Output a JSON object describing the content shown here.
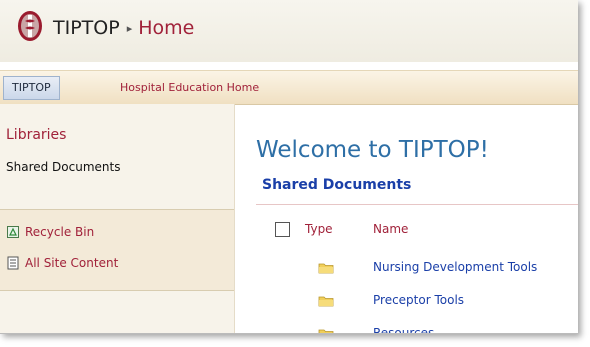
{
  "header": {
    "site_name": "TIPTOP",
    "breadcrumb_separator": "▸",
    "current_page": "Home"
  },
  "topnav": {
    "active_tab": "TIPTOP",
    "tabs": [
      "Hospital Education Home"
    ]
  },
  "quicklaunch": {
    "heading": "Libraries",
    "items": [
      "Shared Documents"
    ],
    "links": [
      {
        "label": "Recycle Bin",
        "icon": "recycle-bin-icon"
      },
      {
        "label": "All Site Content",
        "icon": "site-content-icon"
      }
    ]
  },
  "main": {
    "welcome": "Welcome to TIPTOP!",
    "section_title": "Shared Documents",
    "columns": {
      "type": "Type",
      "name": "Name"
    },
    "rows": [
      {
        "name": "Nursing Development Tools",
        "icon": "folder-icon"
      },
      {
        "name": "Preceptor Tools",
        "icon": "folder-icon"
      },
      {
        "name": "Resources",
        "icon": "folder-icon"
      }
    ]
  },
  "colors": {
    "accent_red": "#a1223a",
    "link_blue": "#1a3fa8",
    "heading_blue": "#2e6fa6"
  }
}
